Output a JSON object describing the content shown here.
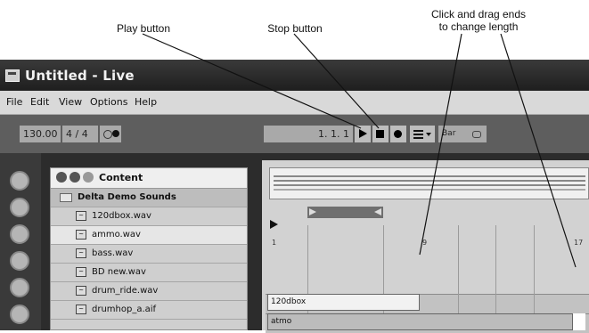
{
  "annotations": {
    "play": "Play button",
    "stop": "Stop button",
    "drag_line1": "Click and drag ends",
    "drag_line2": "to change length"
  },
  "window": {
    "title": "Untitled - Live"
  },
  "menu": [
    "File",
    "Edit",
    "View",
    "Options",
    "Help"
  ],
  "control_bar": {
    "tempo": "130.00",
    "signature": "4 / 4",
    "position": "1.  1.  1",
    "quantize": "Bar"
  },
  "browser": {
    "header": "Content",
    "folder": "Delta Demo Sounds",
    "files": [
      "120dbox.wav",
      "ammo.wav",
      "bass.wav",
      "BD new.wav",
      "drum_ride.wav",
      "drumhop_a.aif"
    ]
  },
  "arrangement": {
    "ruler": [
      "1",
      "9",
      "17"
    ],
    "clips": [
      "120dbox",
      "atmo"
    ]
  },
  "colors": {
    "titlebar": "#2a2a2a",
    "menubar": "#d9d9d9",
    "accent": "#000000"
  },
  "icons": [
    "app-icon",
    "play-icon",
    "stop-icon",
    "record-icon",
    "wav-file-icon",
    "folder-icon"
  ]
}
